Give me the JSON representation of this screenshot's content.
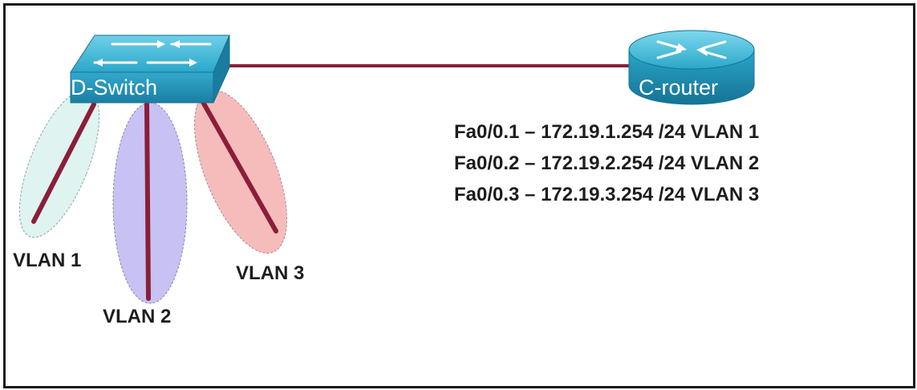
{
  "switch": {
    "name": "D-Switch"
  },
  "router": {
    "name": "C-router"
  },
  "interfaces": [
    {
      "text": "Fa0/0.1 – 172.19.1.254 /24 VLAN 1"
    },
    {
      "text": "Fa0/0.2 – 172.19.2.254 /24 VLAN 2"
    },
    {
      "text": "Fa0/0.3 – 172.19.3.254 /24 VLAN 3"
    }
  ],
  "vlans": [
    {
      "label": "VLAN 1",
      "fill": "#dff3f0"
    },
    {
      "label": "VLAN 2",
      "fill": "#c7c2f3"
    },
    {
      "label": "VLAN 3",
      "fill": "#f6bcbc"
    }
  ],
  "colors": {
    "link": "#8b1e3a",
    "device": "#2aa7c9",
    "device_dark": "#17708f"
  }
}
